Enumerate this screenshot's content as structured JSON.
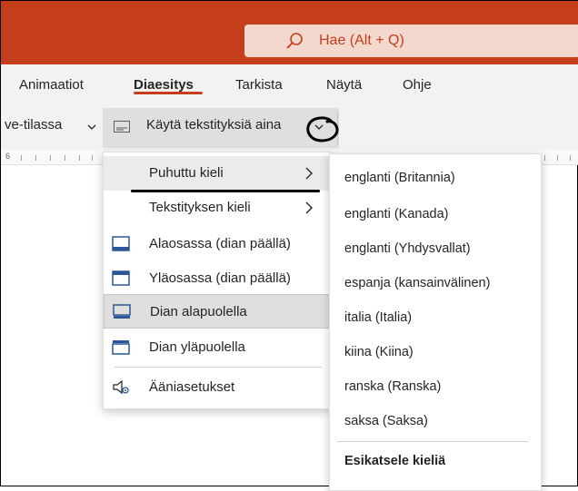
{
  "search": {
    "icon": "search-icon",
    "text": "Hae (Alt + Q)"
  },
  "tabs": [
    {
      "label": "Animaatiot",
      "active": false
    },
    {
      "label": "Diaesitys",
      "active": true
    },
    {
      "label": "Tarkista",
      "active": false
    },
    {
      "label": "Näytä",
      "active": false
    },
    {
      "label": "Ohje",
      "active": false
    }
  ],
  "ribbon": {
    "live_mode_label": "ve-tilassa",
    "subtitles_label": "Käytä tekstityksiä aina",
    "ruler_number": "6"
  },
  "menu": {
    "items": [
      {
        "label": "Puhuttu kieli",
        "icon": "",
        "submenu": true
      },
      {
        "label": "Tekstityksen kieli",
        "icon": "",
        "submenu": true
      },
      {
        "label": "Alaosassa (dian päällä)",
        "icon": "caption-bottom-overlay-icon"
      },
      {
        "label": "Yläosassa (dian päällä)",
        "icon": "caption-top-overlay-icon"
      },
      {
        "label": "Dian alapuolella",
        "icon": "caption-below-slide-icon",
        "selected": true
      },
      {
        "label": "Dian yläpuolella",
        "icon": "caption-above-slide-icon"
      },
      {
        "label": "Ääniasetukset",
        "icon": "audio-settings-icon"
      }
    ]
  },
  "submenu": {
    "items": [
      "englanti (Britannia)",
      "englanti (Kanada)",
      "englanti (Yhdysvallat)",
      "espanja (kansainvälinen)",
      "italia (Italia)",
      "kiina (Kiina)",
      "ranska (Ranska)",
      "saksa (Saksa)"
    ],
    "preview": "Esikatsele kieliä"
  },
  "colors": {
    "accent": "#c43e1c",
    "search_bg": "#f3d9cd",
    "ribbon_bg": "#f3f2f1"
  }
}
